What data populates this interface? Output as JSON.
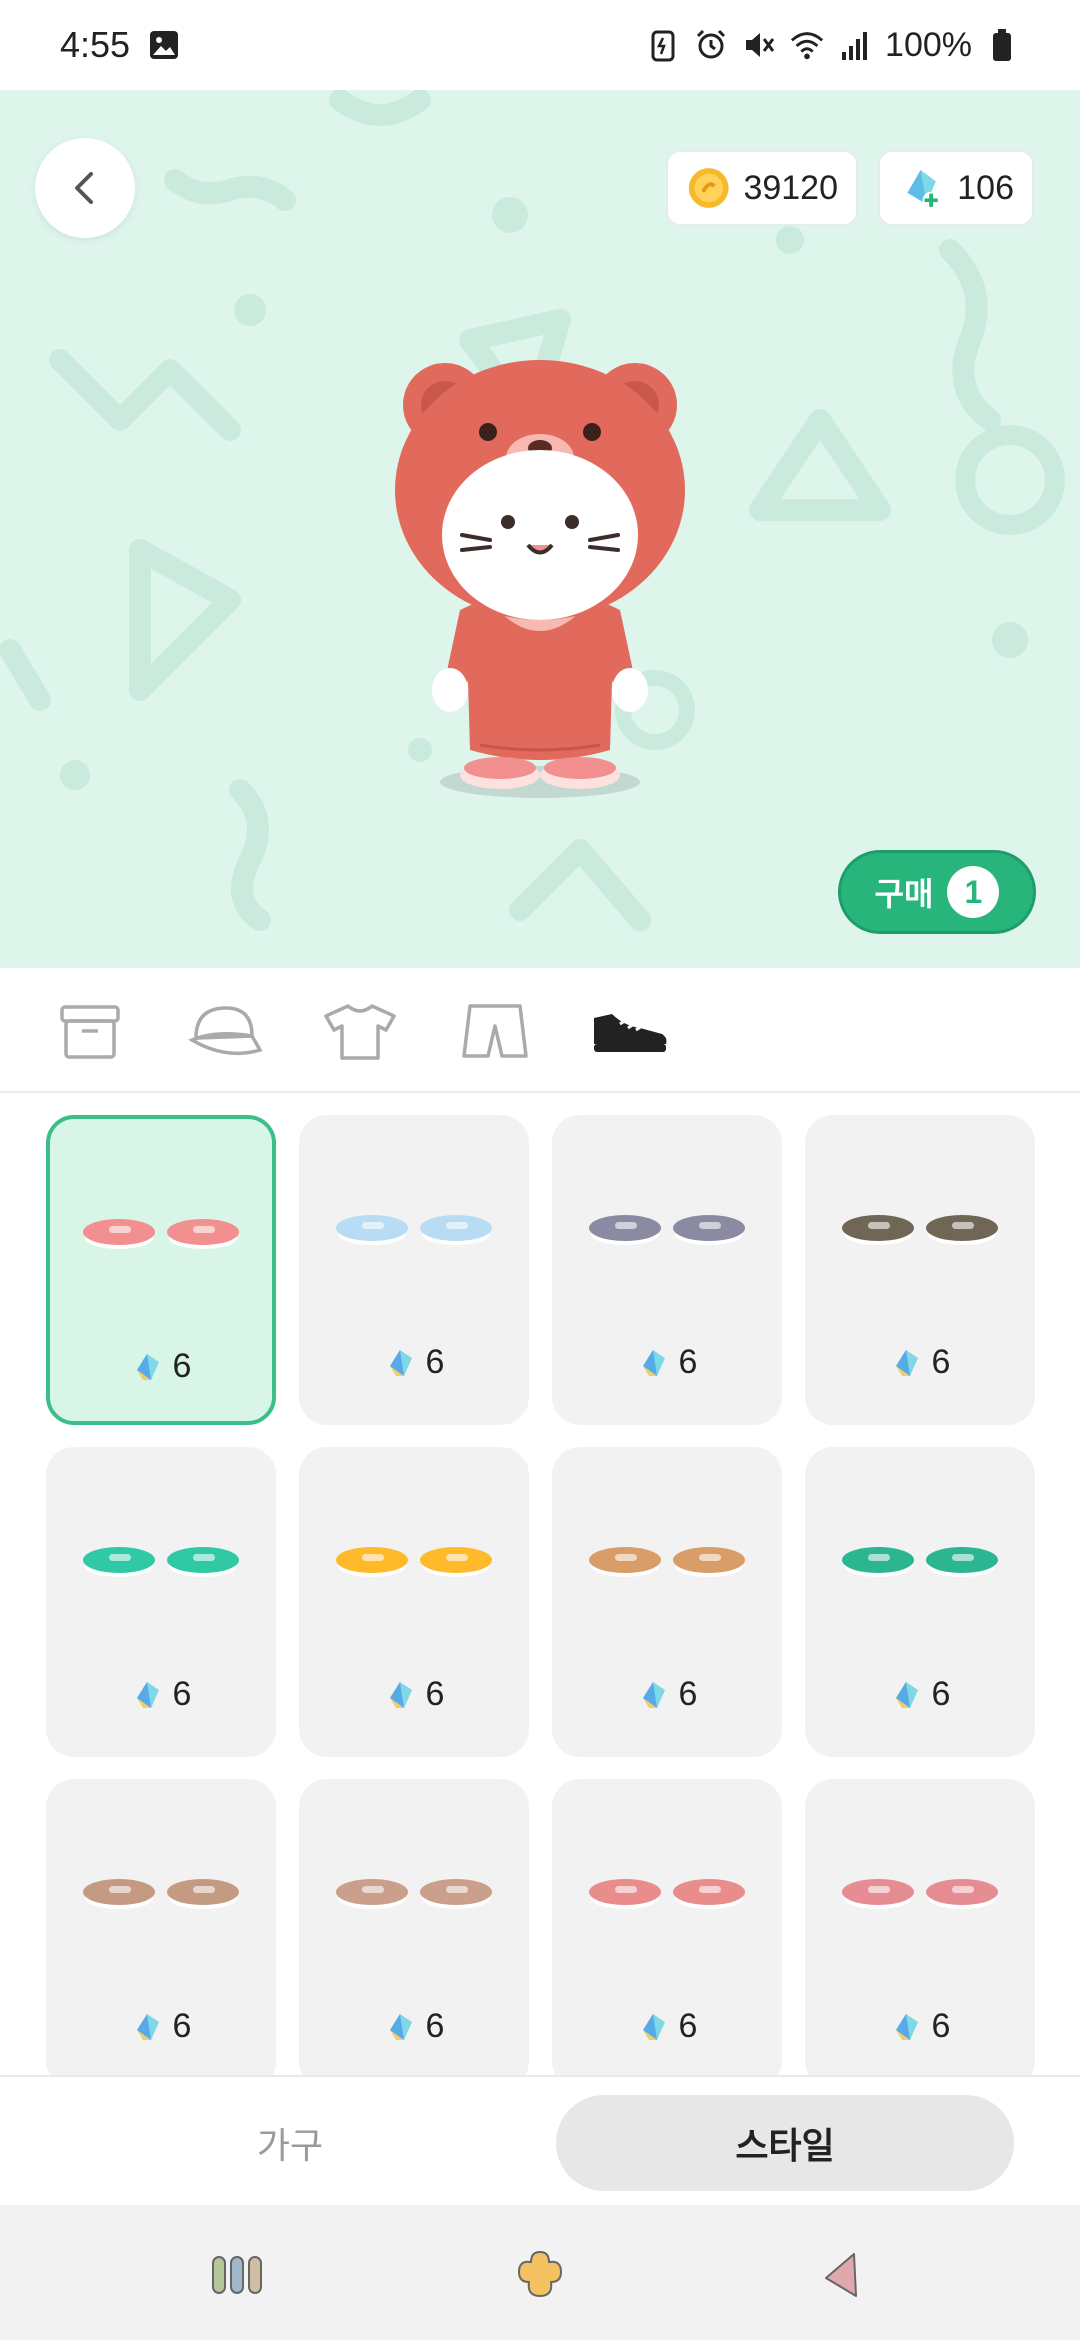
{
  "status_bar": {
    "time": "4:55",
    "battery": "100%"
  },
  "hero": {
    "coins": "39120",
    "gems": "106",
    "buy_label": "구매",
    "buy_count": "1"
  },
  "category_tabs": [
    {
      "icon": "box-icon",
      "active": false
    },
    {
      "icon": "cap-icon",
      "active": false
    },
    {
      "icon": "tshirt-icon",
      "active": false
    },
    {
      "icon": "shorts-icon",
      "active": false
    },
    {
      "icon": "sneaker-icon",
      "active": true
    }
  ],
  "items": [
    {
      "price": "6",
      "color": "#f28f8f",
      "selected": true
    },
    {
      "price": "6",
      "color": "#b9dcf5"
    },
    {
      "price": "6",
      "color": "#8b8aa3"
    },
    {
      "price": "6",
      "color": "#6f6656"
    },
    {
      "price": "6",
      "color": "#2fc9a5"
    },
    {
      "price": "6",
      "color": "#ffba2c"
    },
    {
      "price": "6",
      "color": "#d99d6a"
    },
    {
      "price": "6",
      "color": "#2bb591"
    },
    {
      "price": "6",
      "color": "#c49a82"
    },
    {
      "price": "6",
      "color": "#caa08c"
    },
    {
      "price": "6",
      "color": "#e88c8c"
    },
    {
      "price": "6",
      "color": "#e58d92"
    }
  ],
  "bottom_toggle": {
    "furniture": "가구",
    "style": "스타일"
  },
  "colors": {
    "hero_bg": "#def5ec",
    "accent_green": "#27b57c",
    "card_bg": "#f2f2f3",
    "selected_card_bg": "#d9f5e8"
  }
}
